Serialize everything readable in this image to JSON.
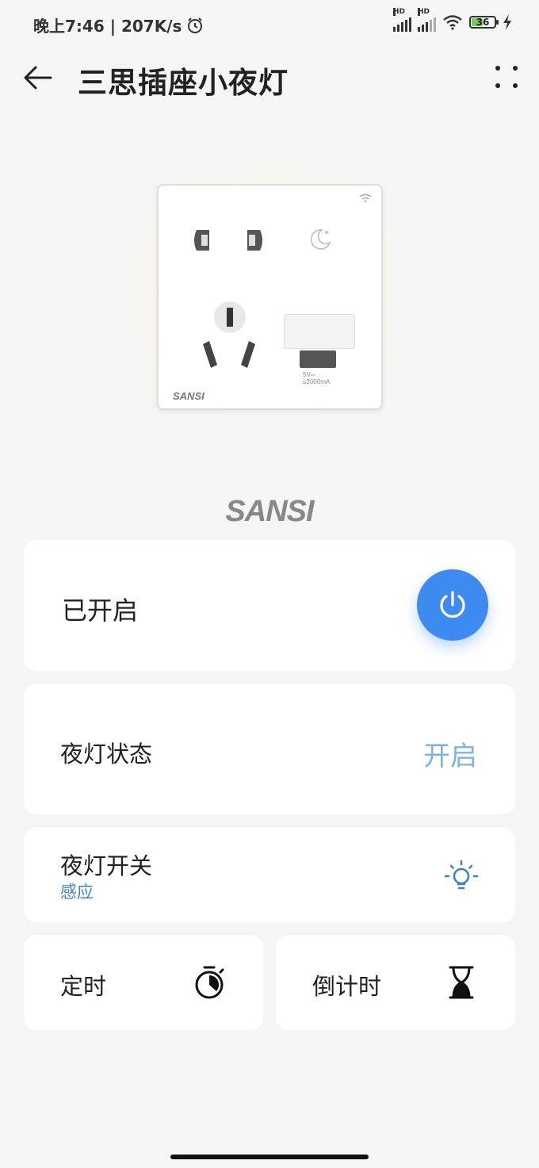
{
  "status_bar": {
    "time_speed": "晚上7:46 | 207K/s",
    "network_1": "HD",
    "network_2": "HD",
    "battery": "36"
  },
  "header": {
    "title": "三思插座小夜灯",
    "back_icon": "arrow-left-icon",
    "more_icon": "more-dots-icon"
  },
  "device": {
    "usb_spec_line1": "5V⎓",
    "usb_spec_line2": "≤2000mA",
    "socket_brand": "SANSI",
    "brand_logo": "SANSI"
  },
  "power_card": {
    "status_label": "已开启",
    "power_icon": "power-icon",
    "accent_color": "#3d8af0"
  },
  "state_card": {
    "label": "夜灯状态",
    "value": "开启",
    "value_color": "#7db3e6"
  },
  "switch_card": {
    "label": "夜灯开关",
    "mode": "感应",
    "icon": "light-bulb-icon"
  },
  "timer_card": {
    "label": "定时",
    "icon": "stopwatch-icon"
  },
  "countdown_card": {
    "label": "倒计时",
    "icon": "hourglass-icon"
  }
}
